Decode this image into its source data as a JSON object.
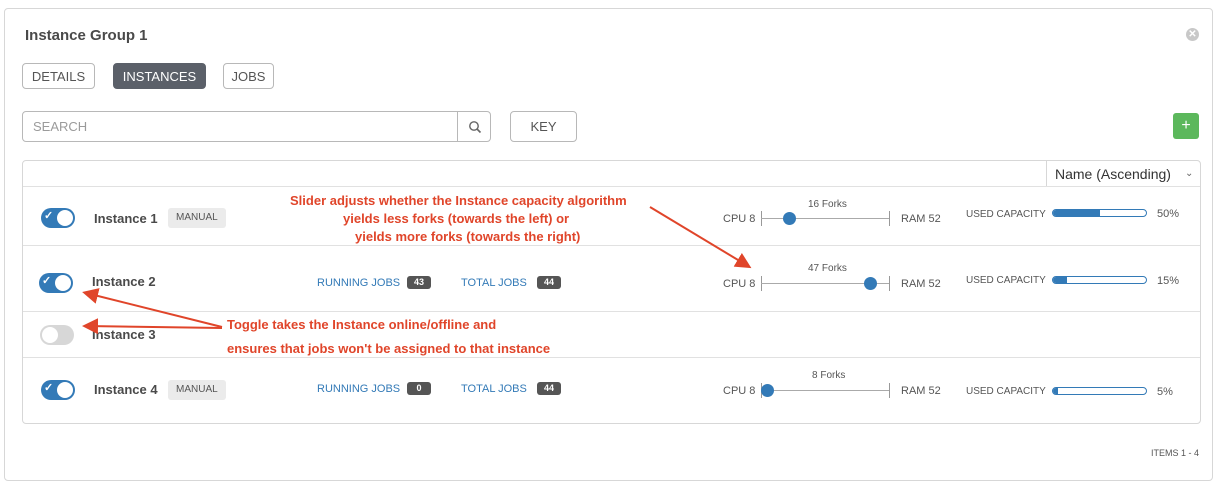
{
  "window": {
    "title": "Instance Group 1",
    "close_icon": "close-icon"
  },
  "tabs": [
    {
      "label": "DETAILS",
      "active": false
    },
    {
      "label": "INSTANCES",
      "active": true
    },
    {
      "label": "JOBS",
      "active": false
    }
  ],
  "search": {
    "placeholder": "SEARCH",
    "value": "",
    "icon": "search-icon"
  },
  "key_button": "KEY",
  "add_button": "+",
  "sort": {
    "selected": "Name (Ascending)"
  },
  "instances": [
    {
      "name": "Instance 1",
      "enabled": true,
      "badge": "MANUAL",
      "running_jobs_label": "",
      "running_jobs": "",
      "total_jobs_label": "",
      "total_jobs": "",
      "cpu": "CPU 8",
      "forks": "16 Forks",
      "slider_fraction": 0.22,
      "ram": "RAM 52",
      "used_capacity_label": "USED CAPACITY",
      "used_capacity_fraction": 0.5,
      "used_capacity": "50%"
    },
    {
      "name": "Instance 2",
      "enabled": true,
      "badge": "",
      "running_jobs_label": "RUNNING JOBS",
      "running_jobs": "43",
      "total_jobs_label": "TOTAL JOBS",
      "total_jobs": "44",
      "cpu": "CPU 8",
      "forks": "47 Forks",
      "slider_fraction": 0.85,
      "ram": "RAM 52",
      "used_capacity_label": "USED CAPACITY",
      "used_capacity_fraction": 0.15,
      "used_capacity": "15%"
    },
    {
      "name": "Instance 3",
      "enabled": false
    },
    {
      "name": "Instance 4",
      "enabled": true,
      "badge": "MANUAL",
      "running_jobs_label": "RUNNING JOBS",
      "running_jobs": "0",
      "total_jobs_label": "TOTAL JOBS",
      "total_jobs": "44",
      "cpu": "CPU 8",
      "forks": "8 Forks",
      "slider_fraction": 0.05,
      "ram": "RAM 52",
      "used_capacity_label": "USED CAPACITY",
      "used_capacity_fraction": 0.05,
      "used_capacity": "5%"
    }
  ],
  "annotations": {
    "slider_note": [
      "Slider adjusts whether the Instance capacity algorithm",
      "yields less forks (towards the left) or",
      "yields more forks (towards the right)"
    ],
    "toggle_note": [
      "Toggle takes the Instance online/offline and",
      "ensures that jobs won't be assigned to that instance"
    ],
    "color": "#e0452a"
  },
  "footer": {
    "items": "ITEMS  1 - 4"
  },
  "colors": {
    "accent": "#337ab7",
    "active_tab": "#5b6069",
    "add_button": "#5cb85c"
  }
}
